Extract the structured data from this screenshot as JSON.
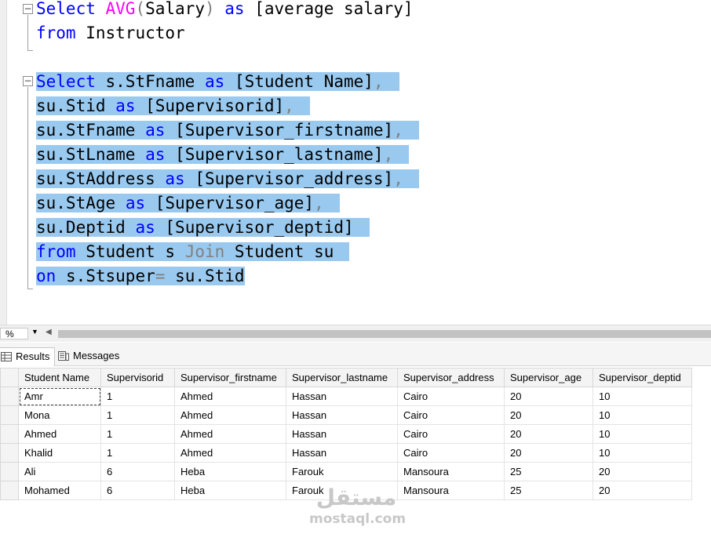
{
  "editor": {
    "query1": {
      "line1": {
        "kw1": "Select",
        "fn": "AVG",
        "open": "(",
        "arg": "Salary",
        "close": ")",
        "kw2": "as",
        "alias": "[average salary]"
      },
      "line2": {
        "kw": "from",
        "table": "Instructor"
      }
    },
    "query2": {
      "l1": {
        "kw1": "Select",
        "expr": "s.StFname",
        "kw2": "as",
        "alias": "[Student Name]",
        "comma": ","
      },
      "l2": {
        "expr": "su.Stid",
        "kw": "as",
        "alias": "[Supervisorid]",
        "comma": ","
      },
      "l3": {
        "expr": "su.StFname",
        "kw": "as",
        "alias": "[Supervisor_firstname]",
        "comma": ","
      },
      "l4": {
        "expr": "su.StLname",
        "kw": "as",
        "alias": "[Supervisor_lastname]",
        "comma": ","
      },
      "l5": {
        "expr": "su.StAddress",
        "kw": "as",
        "alias": "[Supervisor_address]",
        "comma": ","
      },
      "l6": {
        "expr": "su.StAge",
        "kw": "as",
        "alias": "[Supervisor_age]",
        "comma": ","
      },
      "l7": {
        "expr": "su.Deptid",
        "kw": "as",
        "alias": "[Supervisor_deptid]"
      },
      "l8": {
        "kw1": "from",
        "t1": "Student s",
        "kw2": "Join",
        "t2": "Student su"
      },
      "l9": {
        "kw": "on",
        "left": "s.Stsuper",
        "op": "=",
        "right": "su.Stid"
      }
    }
  },
  "zoom": {
    "value": "%"
  },
  "tabs": {
    "results": "Results",
    "messages": "Messages"
  },
  "results": {
    "columns": [
      "Student Name",
      "Supervisorid",
      "Supervisor_firstname",
      "Supervisor_lastname",
      "Supervisor_address",
      "Supervisor_age",
      "Supervisor_deptid"
    ],
    "rows": [
      [
        "Amr",
        "1",
        "Ahmed",
        "Hassan",
        "Cairo",
        "20",
        "10"
      ],
      [
        "Mona",
        "1",
        "Ahmed",
        "Hassan",
        "Cairo",
        "20",
        "10"
      ],
      [
        "Ahmed",
        "1",
        "Ahmed",
        "Hassan",
        "Cairo",
        "20",
        "10"
      ],
      [
        "Khalid",
        "1",
        "Ahmed",
        "Hassan",
        "Cairo",
        "20",
        "10"
      ],
      [
        "Ali",
        "6",
        "Heba",
        "Farouk",
        "Mansoura",
        "25",
        "20"
      ],
      [
        "Mohamed",
        "6",
        "Heba",
        "Farouk",
        "Mansoura",
        "25",
        "20"
      ]
    ]
  },
  "watermark": {
    "arabic": "مستقل",
    "latin": "mostaql.com"
  },
  "colors": {
    "keyword": "#0000ff",
    "function": "#ff00ff",
    "operator": "#808080",
    "selection": "#99c9ef"
  }
}
